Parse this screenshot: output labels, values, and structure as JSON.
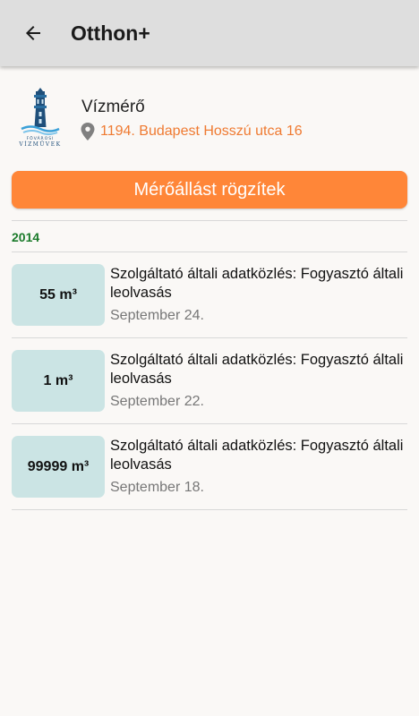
{
  "appbar": {
    "title": "Otthon+",
    "back_icon": "arrow-left-icon"
  },
  "meter": {
    "name": "Vízmérő",
    "address": "1194. Budapest Hosszú utca 16",
    "logo_text_top": "FŐVÁROSI",
    "logo_text_bottom": "VÍZMŰVEK",
    "accent_color": "#ef7a31"
  },
  "record_button": {
    "label": "Mérőállást rögzítek",
    "color": "#ff8638"
  },
  "year_label": "2014",
  "readings": [
    {
      "value": "55 m³",
      "description": "Szolgáltató általi adatközlés: Fogyasztó általi leolvasás",
      "date": "September 24."
    },
    {
      "value": "1 m³",
      "description": "Szolgáltató általi adatközlés: Fogyasztó általi leolvasás",
      "date": "September 22."
    },
    {
      "value": "99999 m³",
      "description": "Szolgáltató általi adatközlés: Fogyasztó általi leolvasás",
      "date": "September 18."
    }
  ]
}
